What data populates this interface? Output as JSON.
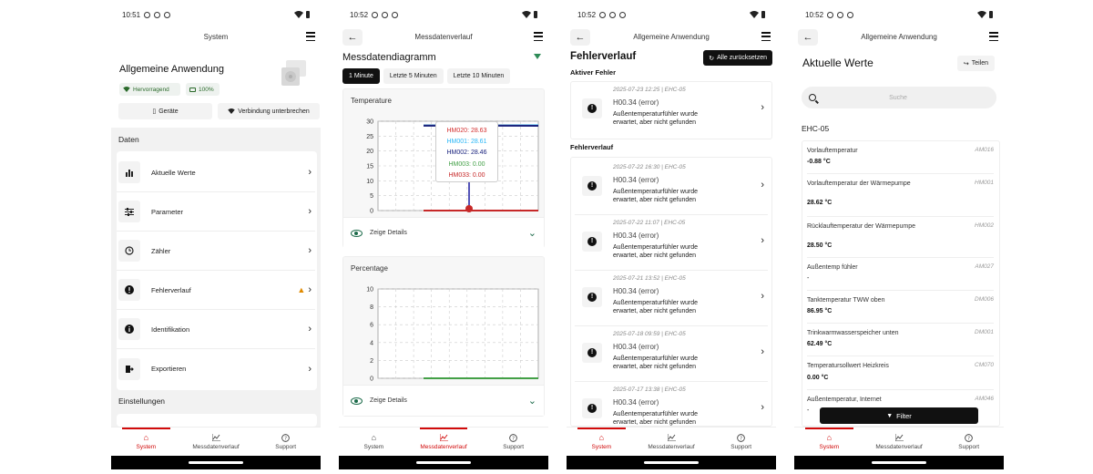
{
  "colors": {
    "accent": "#d10a0a",
    "green": "#2e8b57",
    "dark": "#111111"
  },
  "status": {
    "time_p1": "10:51",
    "time_p2": "10:52",
    "time_p3": "10:52",
    "time_p4": "10:52"
  },
  "nav": {
    "system": "System",
    "messdaten": "Messdatenverlauf",
    "support": "Support"
  },
  "p1": {
    "appbar_title": "System",
    "title": "Allgemeine Anwendung",
    "wifi_chip": "Hervorragend",
    "battery_chip": "100%",
    "btn_devices": "Geräte",
    "btn_connection": "Verbindung unterbrechen",
    "section_data": "Daten",
    "items": [
      {
        "label": "Aktuelle Werte",
        "icon": "bar-chart-icon"
      },
      {
        "label": "Parameter",
        "icon": "sliders-icon"
      },
      {
        "label": "Zähler",
        "icon": "clock-icon"
      },
      {
        "label": "Fehlerverlauf",
        "icon": "alert-circle-icon"
      },
      {
        "label": "Identifikation",
        "icon": "info-icon"
      },
      {
        "label": "Exportieren",
        "icon": "export-icon"
      }
    ],
    "section_settings": "Einstellungen"
  },
  "p2": {
    "appbar_title": "Messdatenverlauf",
    "title": "Messdatendiagramm",
    "tabs": [
      "1 Minute",
      "Letzte 5 Minuten",
      "Letzte 10 Minuten"
    ],
    "details_label": "Zeige Details",
    "tooltip": [
      {
        "text": "HM020: 28.63",
        "color": "#d32f2f"
      },
      {
        "text": "HM001: 28.61",
        "color": "#29b6f6"
      },
      {
        "text": "HM002: 28.46",
        "color": "#1a237e"
      },
      {
        "text": "HM003: 0.00",
        "color": "#43a047"
      },
      {
        "text": "HM033: 0.00",
        "color": "#c62828"
      }
    ]
  },
  "chart_data": [
    {
      "type": "line",
      "title": "Temperature",
      "ylim": [
        0,
        30
      ],
      "yticks": [
        0,
        5,
        10,
        15,
        20,
        25,
        30
      ],
      "series": [
        {
          "name": "HM020",
          "color": "#d32f2f",
          "values": [
            28.6,
            28.6,
            28.6,
            28.63
          ]
        },
        {
          "name": "HM001",
          "color": "#29b6f6",
          "values": [
            28.6,
            28.6,
            28.6,
            28.61
          ]
        },
        {
          "name": "HM002",
          "color": "#1a237e",
          "values": [
            28.5,
            28.5,
            28.5,
            28.46
          ]
        },
        {
          "name": "HM003",
          "color": "#43a047",
          "values": [
            0,
            0,
            0,
            0
          ]
        },
        {
          "name": "HM033",
          "color": "#c62828",
          "values": [
            0,
            0,
            0,
            0
          ]
        }
      ],
      "grid": true
    },
    {
      "type": "line",
      "title": "Percentage",
      "ylim": [
        0,
        10
      ],
      "yticks": [
        0,
        2,
        4,
        6,
        8,
        10
      ],
      "series": [
        {
          "color": "#43a047",
          "values": [
            0,
            0,
            0,
            0
          ]
        }
      ],
      "grid": true
    }
  ],
  "p3": {
    "appbar_title": "Allgemeine Anwendung",
    "title": "Fehlerverlauf",
    "reset_btn": "Alle zurücksetzen",
    "active_label": "Aktiver Fehler",
    "history_label": "Fehlerverlauf",
    "active": {
      "date": "2025-07-23 12:25 | EHC-05",
      "code": "H00.34 (error)",
      "desc": "Außentemperaturfühler wurde erwartet, aber nicht gefunden"
    },
    "history": [
      {
        "date": "2025-07-22 16:30 | EHC-05",
        "code": "H00.34 (error)",
        "desc": "Außentemperaturfühler wurde erwartet, aber nicht gefunden"
      },
      {
        "date": "2025-07-22 11:07 | EHC-05",
        "code": "H00.34 (error)",
        "desc": "Außentemperaturfühler wurde erwartet, aber nicht gefunden"
      },
      {
        "date": "2025-07-21 13:52 | EHC-05",
        "code": "H00.34 (error)",
        "desc": "Außentemperaturfühler wurde erwartet, aber nicht gefunden"
      },
      {
        "date": "2025-07-18 09:59 | EHC-05",
        "code": "H00.34 (error)",
        "desc": "Außentemperaturfühler wurde erwartet, aber nicht gefunden"
      },
      {
        "date": "2025-07-17 13:38 | EHC-05",
        "code": "H00.34 (error)",
        "desc": "Außentemperaturfühler wurde erwartet, aber nicht gefunden"
      }
    ]
  },
  "p4": {
    "appbar_title": "Allgemeine Anwendung",
    "title": "Aktuelle Werte",
    "share_btn": "Teilen",
    "search_placeholder": "Suche",
    "device": "EHC-05",
    "filter_btn": "Filter",
    "values": [
      {
        "name": "Vorlauftemperatur",
        "value": "-0.88 °C",
        "code": "AM016"
      },
      {
        "name": "Vorlauftemperatur der Wärmepumpe",
        "value": "28.62 °C",
        "code": "HM001"
      },
      {
        "name": "Rücklauftemperatur der Wärmepumpe",
        "value": "28.50 °C",
        "code": "HM002"
      },
      {
        "name": "Außentemp fühler",
        "value": "-",
        "code": "AM027"
      },
      {
        "name": "Tanktemperatur TWW oben",
        "value": "86.95 °C",
        "code": "DM006"
      },
      {
        "name": "Trinkwarmwasserspeicher unten",
        "value": "62.49 °C",
        "code": "DM001"
      },
      {
        "name": "Temperatursollwert Heizkreis",
        "value": "0.00 °C",
        "code": "CM070"
      },
      {
        "name": "Außentemperatur, Internet",
        "value": "-",
        "code": "AM046"
      }
    ]
  }
}
